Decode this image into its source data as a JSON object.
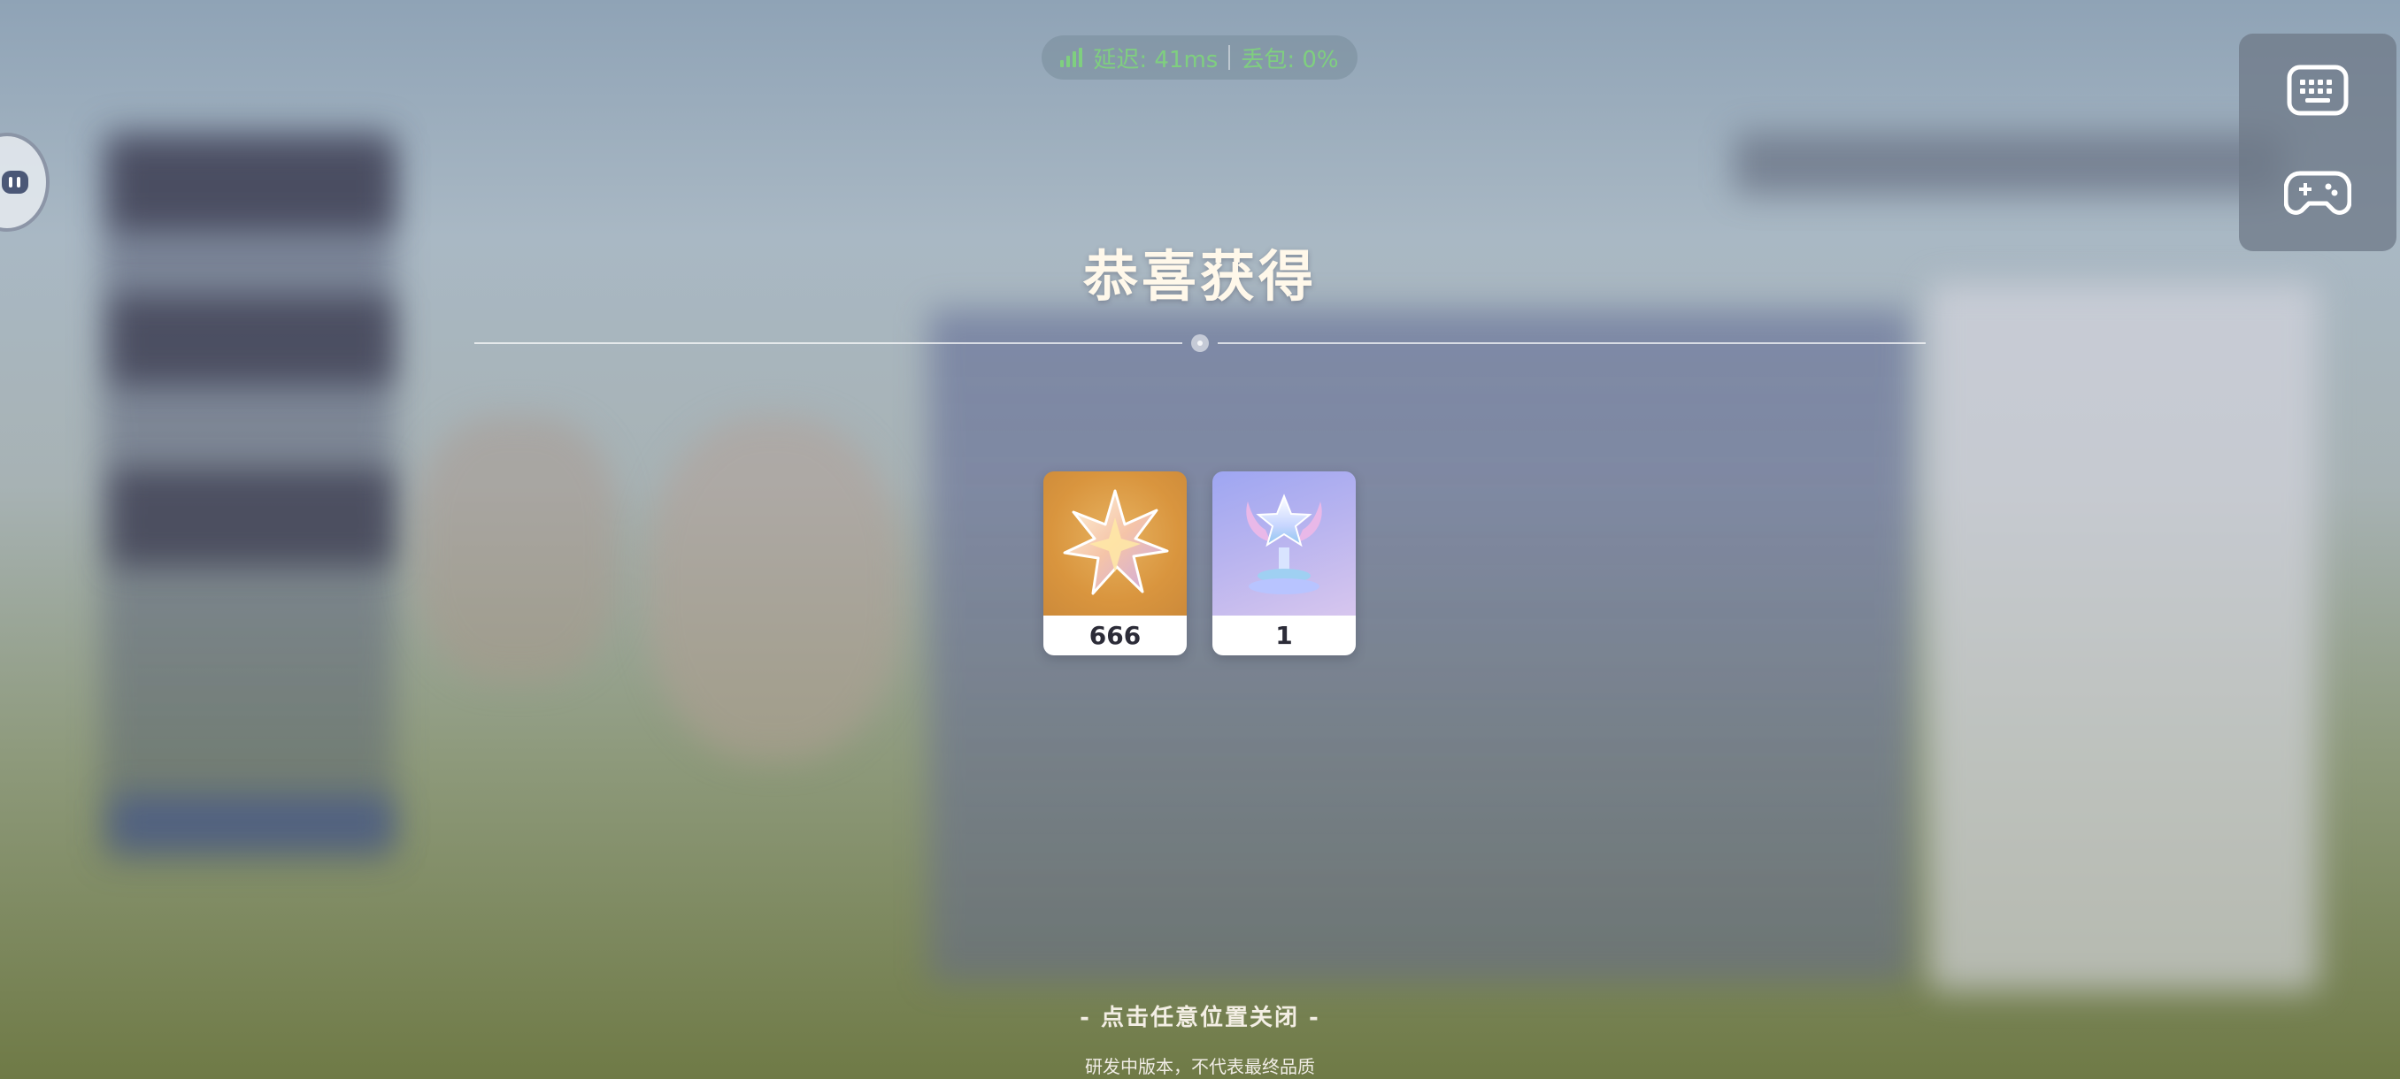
{
  "network": {
    "latency": "延迟: 41ms",
    "packet_loss": "丢包: 0%"
  },
  "popup": {
    "title": "恭喜获得",
    "rewards": [
      {
        "icon": "star-crystal-icon",
        "count": "666"
      },
      {
        "icon": "trophy-icon",
        "count": "1"
      }
    ],
    "close_hint": "- 点击任意位置关闭 -"
  },
  "footer": {
    "disclaimer": "研发中版本，不代表最终品质"
  },
  "controls": {
    "keyboard_icon": "keyboard-icon",
    "gamepad_icon": "gamepad-icon",
    "float_icon": "float-menu-icon"
  },
  "colors": {
    "network_ok": "#7fcf7f",
    "title": "#fff8ea",
    "card1_bg": "#d9953e",
    "card2_bg": "#b7b3ef"
  }
}
